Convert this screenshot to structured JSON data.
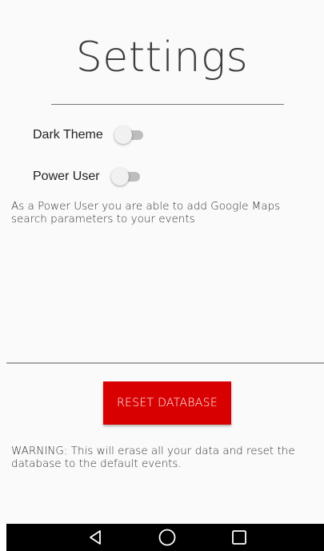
{
  "header": {
    "title": "Settings"
  },
  "settings": {
    "dark_theme": {
      "label": "Dark Theme",
      "enabled": false
    },
    "power_user": {
      "label": "Power User",
      "enabled": false
    },
    "power_user_description": "As a Power User you are able to add Google Maps search parameters to your events"
  },
  "reset": {
    "button_label": "RESET DATABASE",
    "warning": "WARNING: This will erase all your data and reset the database to the default events."
  },
  "nav_bar": {
    "buttons": [
      "back-icon",
      "home-icon",
      "recents-icon"
    ]
  },
  "colors": {
    "accent": "#d80000",
    "background": "#fafafa",
    "nav_bar": "#000000"
  }
}
